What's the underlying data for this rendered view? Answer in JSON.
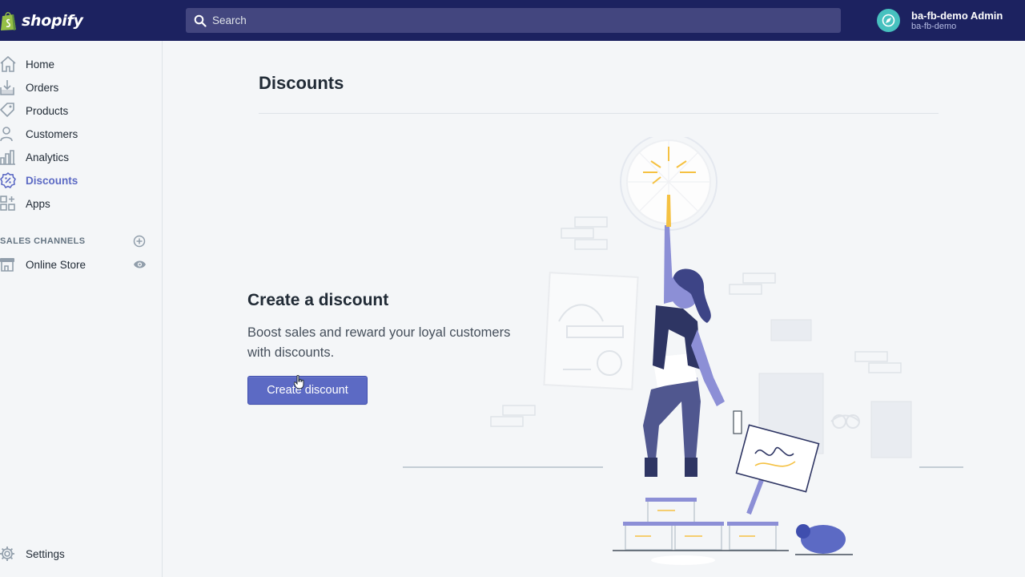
{
  "brand": {
    "name": "shopify"
  },
  "search": {
    "placeholder": "Search"
  },
  "account": {
    "name": "ba-fb-demo Admin",
    "store": "ba-fb-demo"
  },
  "nav": {
    "items": [
      {
        "label": "Home",
        "icon": "home-icon"
      },
      {
        "label": "Orders",
        "icon": "orders-icon"
      },
      {
        "label": "Products",
        "icon": "tag-icon"
      },
      {
        "label": "Customers",
        "icon": "person-icon"
      },
      {
        "label": "Analytics",
        "icon": "bar-chart-icon"
      },
      {
        "label": "Discounts",
        "icon": "discount-icon",
        "active": true
      },
      {
        "label": "Apps",
        "icon": "apps-icon"
      }
    ],
    "sales_channels_title": "SALES CHANNELS",
    "online_store": "Online Store",
    "settings": "Settings"
  },
  "page": {
    "title": "Discounts",
    "empty_heading": "Create a discount",
    "empty_body": "Boost sales and reward your loyal customers with discounts.",
    "cta_label": "Create discount"
  },
  "colors": {
    "topbar": "#1c2260",
    "accent": "#5c6ac4",
    "background": "#f4f6f8"
  }
}
